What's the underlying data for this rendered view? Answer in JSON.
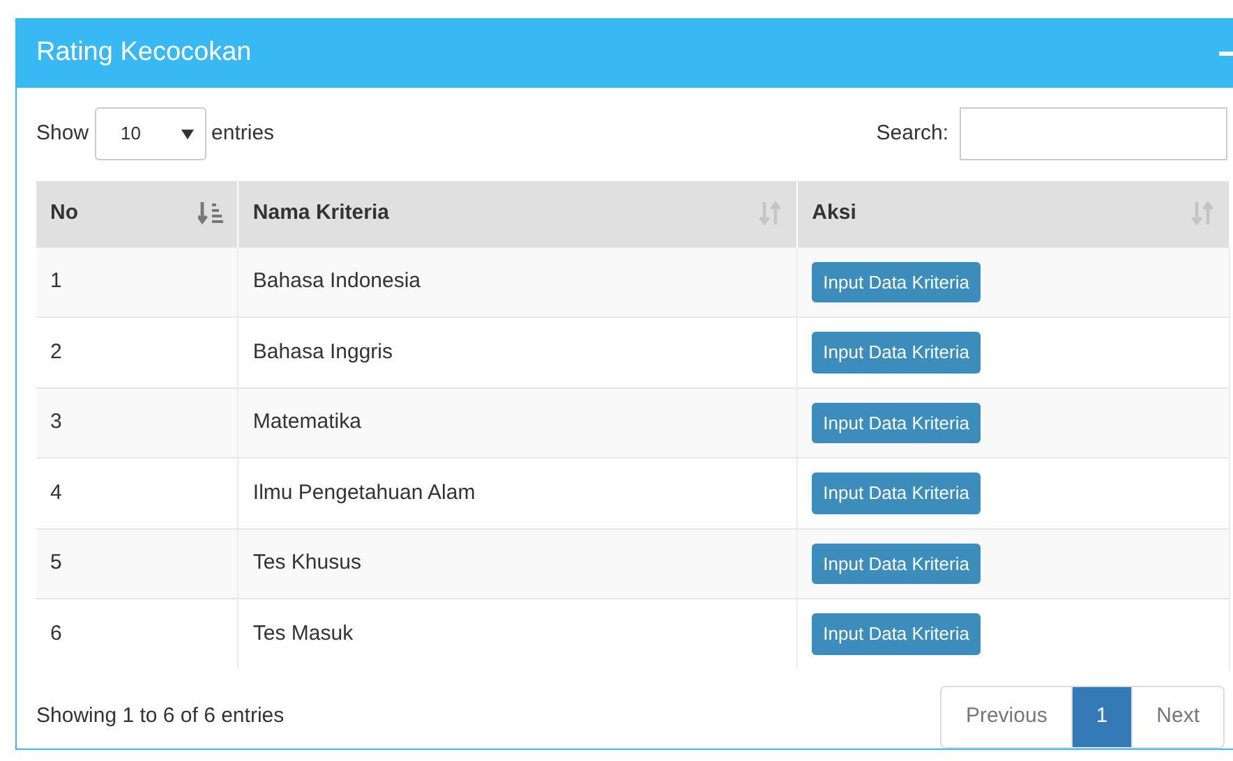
{
  "panel": {
    "title": "Rating Kecocokan",
    "collapsed": false
  },
  "length_menu": {
    "label_before": "Show",
    "value": "10",
    "label_after": "entries"
  },
  "search": {
    "label": "Search:"
  },
  "table": {
    "columns": [
      {
        "label": "No",
        "sorted": true
      },
      {
        "label": "Nama Kriteria",
        "sorted": false
      },
      {
        "label": "Aksi",
        "sorted": false
      }
    ],
    "rows": [
      {
        "no": "1",
        "name": "Bahasa Indonesia",
        "action": "Input Data Kriteria"
      },
      {
        "no": "2",
        "name": "Bahasa Inggris",
        "action": "Input Data Kriteria"
      },
      {
        "no": "3",
        "name": "Matematika",
        "action": "Input Data Kriteria"
      },
      {
        "no": "4",
        "name": "Ilmu Pengetahuan Alam",
        "action": "Input Data Kriteria"
      },
      {
        "no": "5",
        "name": "Tes Khusus",
        "action": "Input Data Kriteria"
      },
      {
        "no": "6",
        "name": "Tes Masuk",
        "action": "Input Data Kriteria"
      }
    ]
  },
  "info": "Showing 1 to 6 of 6 entries",
  "pagination": [
    {
      "label": "Previous",
      "disabled": true,
      "selected": false
    },
    {
      "label": "1",
      "disabled": false,
      "selected": true
    },
    {
      "label": "Next",
      "disabled": true,
      "selected": false
    }
  ]
}
